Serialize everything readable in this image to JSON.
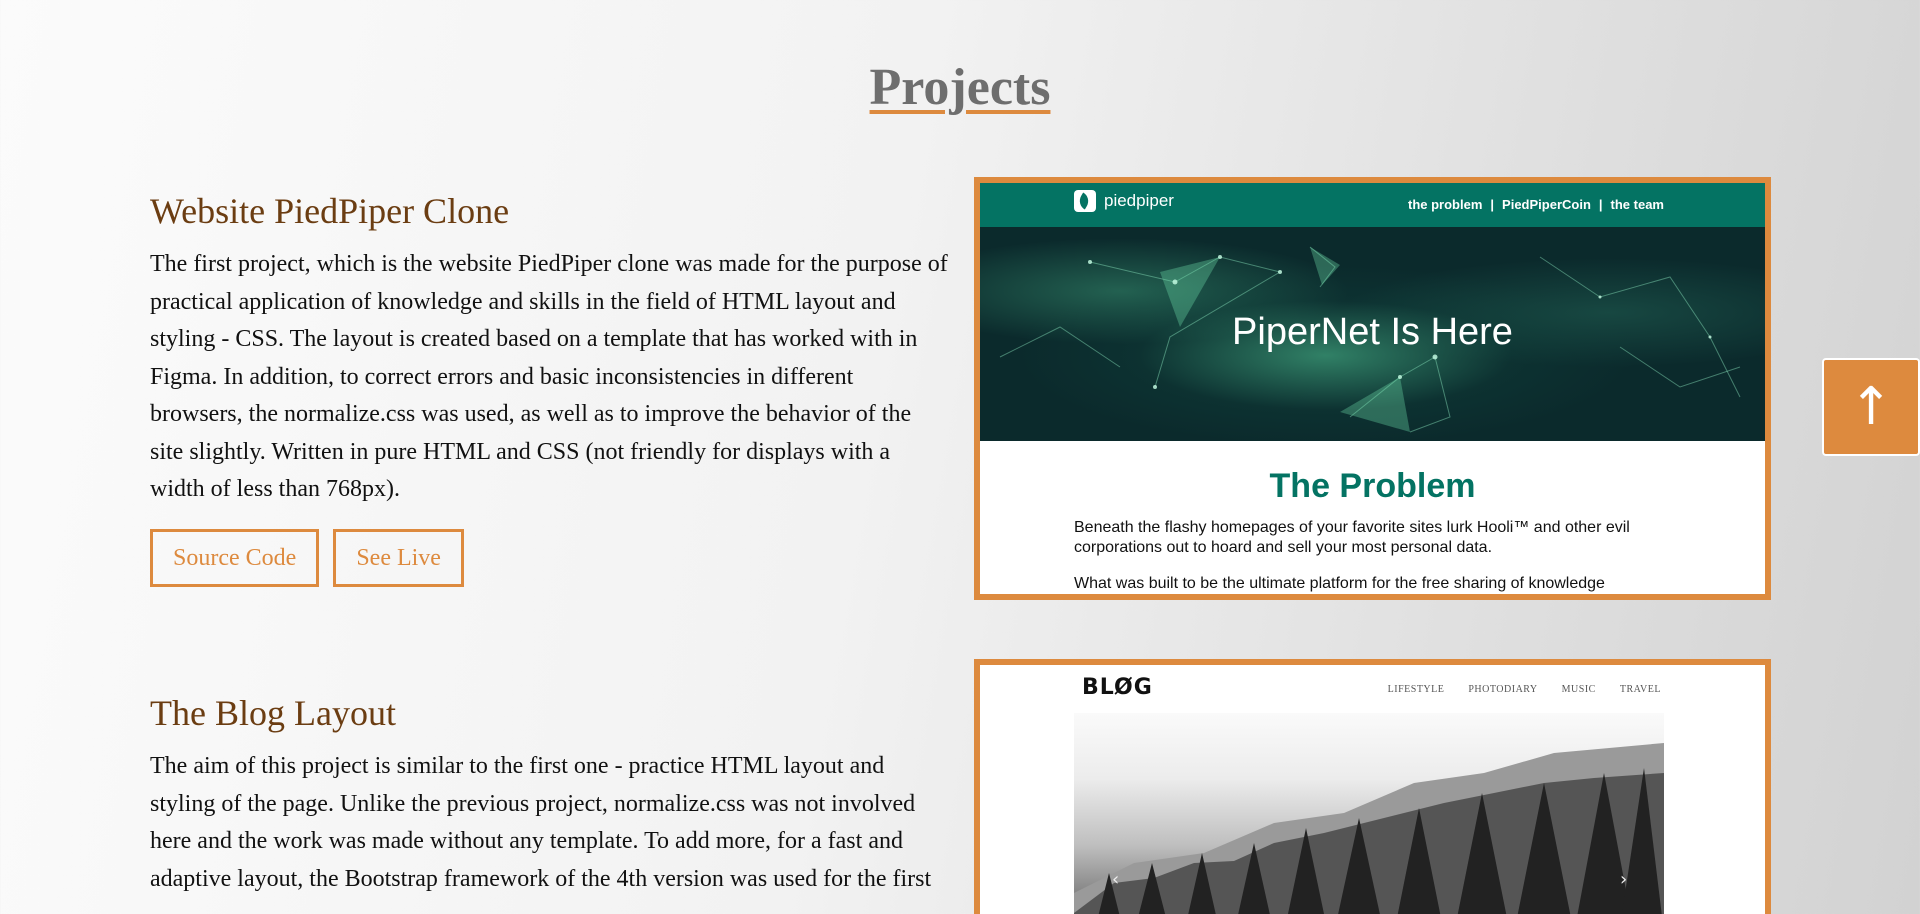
{
  "section": {
    "title": "Projects"
  },
  "projects": [
    {
      "title": "Website PiedPiper Clone",
      "description": "The first project, which is the website PiedPiper clone was made for the purpose of practical application of knowledge and skills in the field of HTML layout and styling - CSS. The layout is created based on a template that has worked with in Figma. In addition, to correct errors and basic inconsistencies in different browsers, the normalize.css was used, as well as to improve the behavior of the site slightly. Written in pure HTML and CSS (not friendly for displays with a width of less than 768px).",
      "buttons": {
        "source": "Source Code",
        "live": "See Live"
      },
      "preview": {
        "logo_text": "piedpiper",
        "nav_links": [
          "the problem",
          "|",
          "PiedPiperCoin",
          "|",
          "the team"
        ],
        "hero_title": "PiperNet Is Here",
        "heading": "The Problem",
        "paragraphs": [
          "Beneath the flashy homepages of your favorite sites lurk Hooli™ and other evil corporations out to hoard and sell your most personal data.",
          "What was built to be the ultimate platform for the free sharing of knowledge"
        ]
      }
    },
    {
      "title": "The Blog Layout",
      "description": "The aim of this project is similar to the first one - practice HTML layout and styling of the page. Unlike the previous project, normalize.css was not involved here and the work was made without any template. To add more, for a fast and adaptive layout, the Bootstrap framework of the 4th version was used for the first",
      "preview": {
        "logo_text": "BLØG",
        "nav_links": [
          "LIFESTYLE",
          "PHOTODIARY",
          "MUSIC",
          "TRAVEL"
        ],
        "prev_arrow": "‹",
        "next_arrow": "›"
      }
    }
  ],
  "scroll_top": {
    "icon": "arrow-up-icon",
    "glyph": "↑"
  },
  "colors": {
    "accent": "#dd8a3e",
    "heading": "#6b3d12",
    "pp_green": "#047363"
  }
}
